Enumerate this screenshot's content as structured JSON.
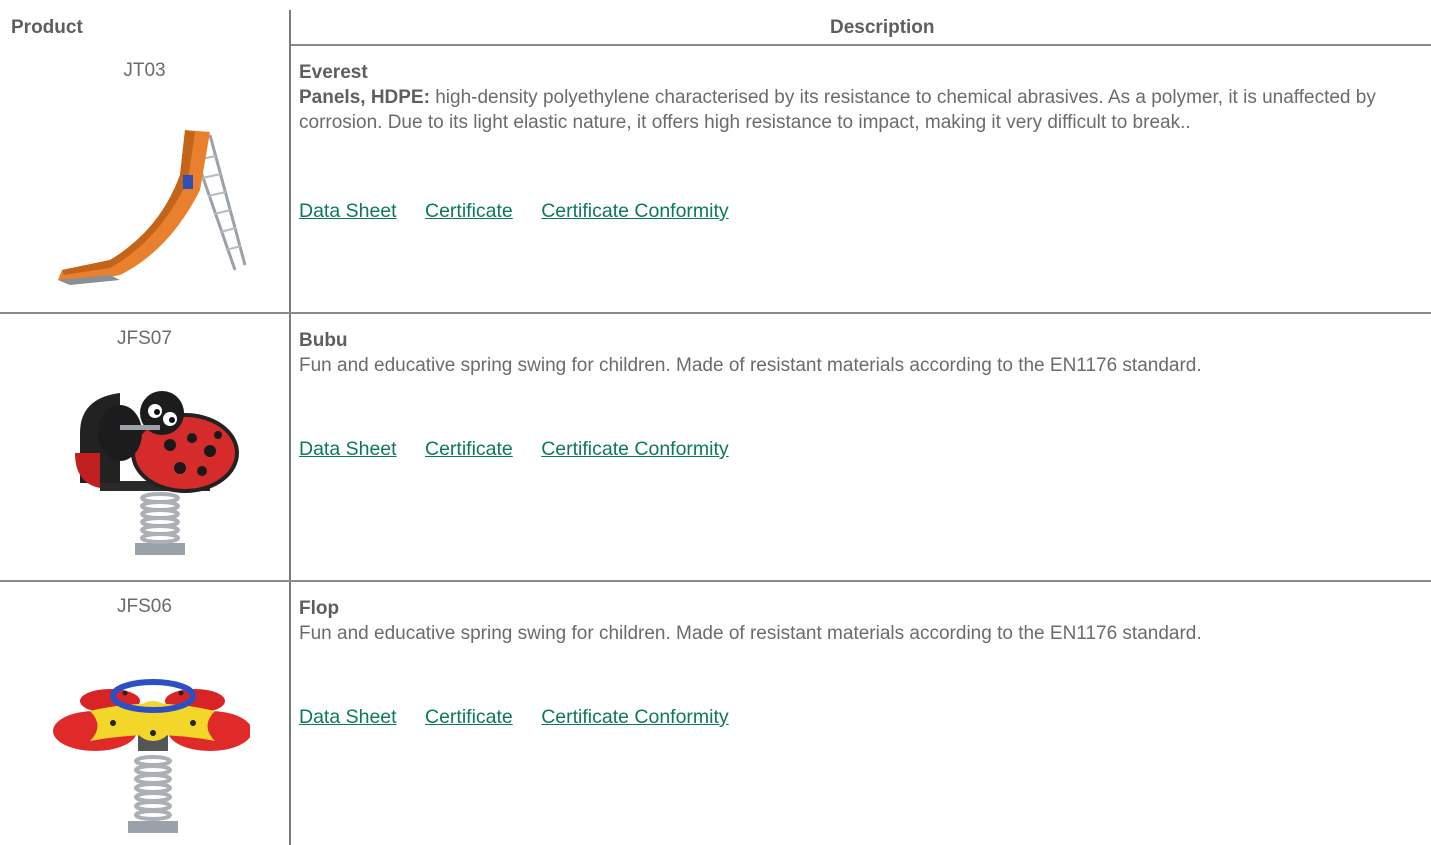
{
  "header": {
    "product": "Product",
    "description": "Description"
  },
  "rows": [
    {
      "code": "JT03",
      "name": "Everest",
      "lead": "Panels, HDPE:",
      "text": " high-density polyethylene characterised by its resistance to chemical abrasives. As a polymer, it is unaffected by corrosion. Due to its light elastic nature, it offers high resistance to impact, making it very difficult to break..",
      "links": [
        "Data Sheet",
        "Certificate",
        "Certificate Conformity"
      ]
    },
    {
      "code": "JFS07",
      "name": "Bubu",
      "lead": "",
      "text": "Fun and educative spring swing for children. Made of resistant materials according to the EN1176 standard.",
      "links": [
        "Data Sheet",
        "Certificate",
        "Certificate Conformity"
      ]
    },
    {
      "code": "JFS06",
      "name": "Flop",
      "lead": "",
      "text": "Fun and educative spring swing for children. Made of resistant materials according to the EN1176 standard.",
      "links": [
        "Data Sheet",
        "Certificate",
        "Certificate Conformity"
      ]
    }
  ],
  "colors": {
    "link": "#0b7a55",
    "text": "#6b6b6b",
    "rule": "#8a8a8a"
  }
}
